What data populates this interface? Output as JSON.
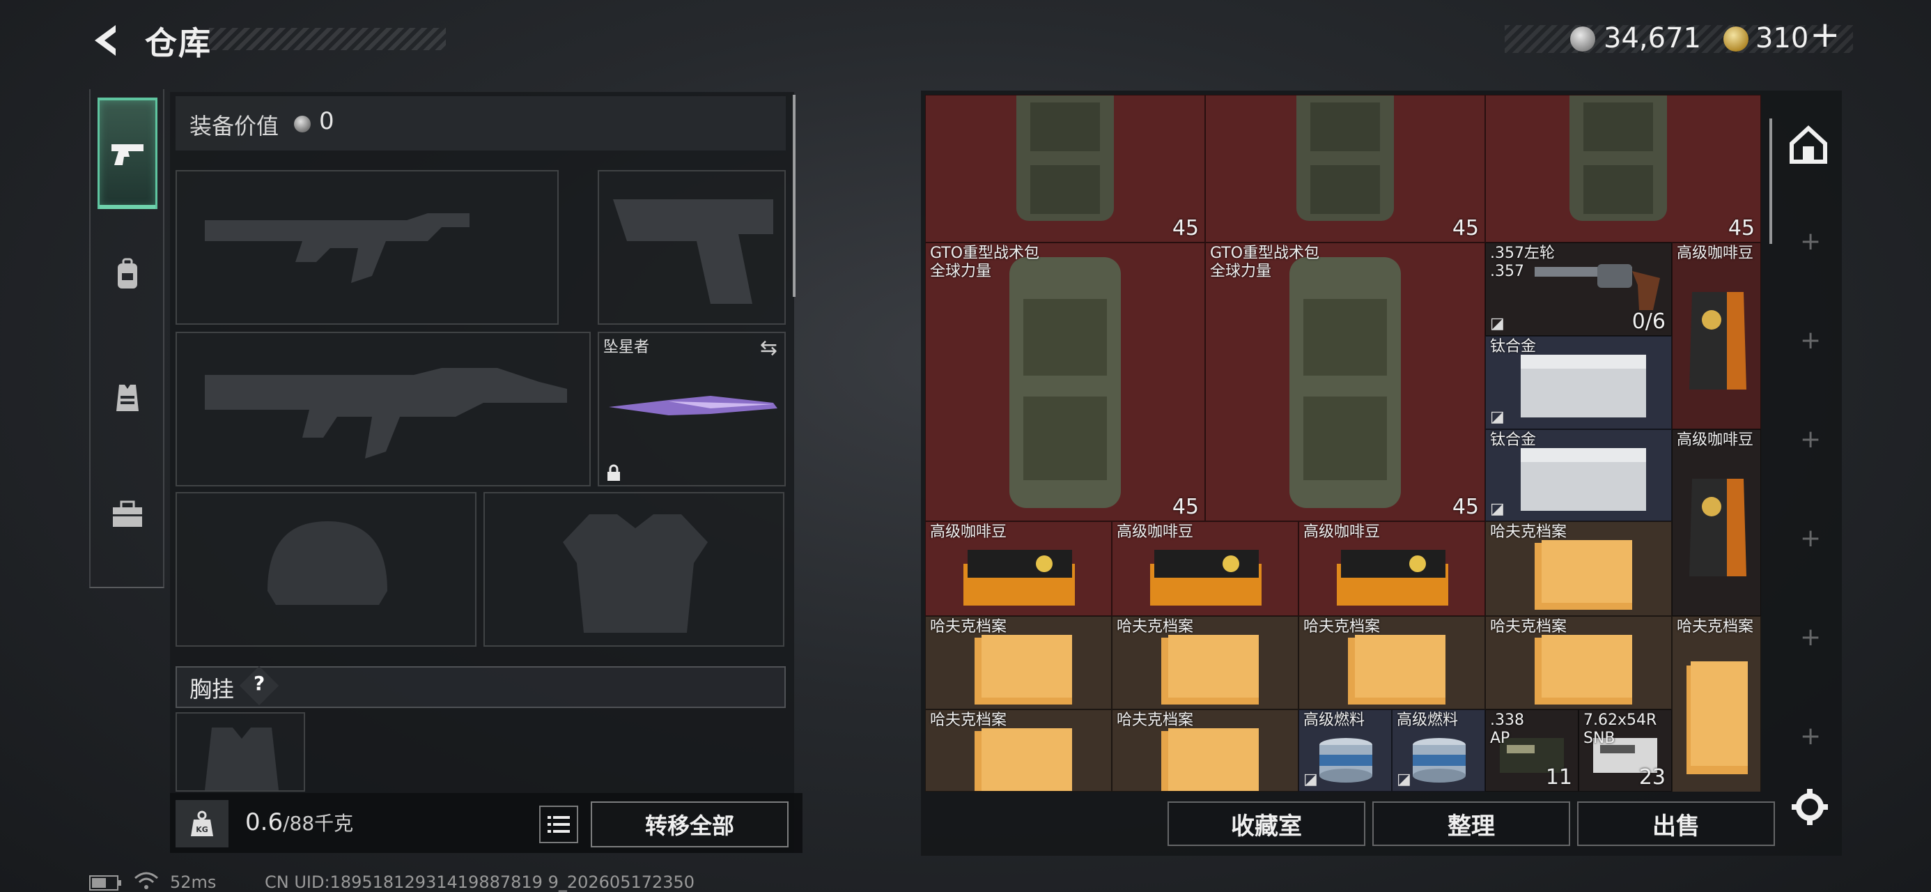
{
  "header": {
    "title": "仓库"
  },
  "currency": {
    "silver": "34,671",
    "gold": "310",
    "plus": "+"
  },
  "equipment": {
    "value_label": "装备价值",
    "value": "0",
    "melee_slot_label": "坠星者",
    "chest_rig_label": "胸挂",
    "chest_rig_help": "?"
  },
  "weight": {
    "current": "0.6",
    "max": "/88千克"
  },
  "buttons": {
    "transfer_all": "转移全部",
    "collection": "收藏室",
    "organize": "整理",
    "sell": "出售"
  },
  "grid_items": [
    {
      "id": "bp1",
      "name": "",
      "count": "45"
    },
    {
      "id": "bp2",
      "name": "",
      "count": "45"
    },
    {
      "id": "bp3",
      "name": "",
      "count": "45"
    },
    {
      "id": "bp4",
      "name": "GTO重型战术包\n全球力量",
      "count": "45"
    },
    {
      "id": "bp5",
      "name": "GTO重型战术包\n全球力量",
      "count": "45"
    },
    {
      "id": "rev",
      "name": ".357左轮\n.357",
      "count": "0/6"
    },
    {
      "id": "cb1",
      "name": "高级咖啡豆",
      "count": ""
    },
    {
      "id": "ti1",
      "name": "钛合金",
      "count": ""
    },
    {
      "id": "ti2",
      "name": "钛合金",
      "count": ""
    },
    {
      "id": "cb2",
      "name": "高级咖啡豆",
      "count": ""
    },
    {
      "id": "cb3",
      "name": "高级咖啡豆",
      "count": ""
    },
    {
      "id": "cb4",
      "name": "高级咖啡豆",
      "count": ""
    },
    {
      "id": "cb5",
      "name": "高级咖啡豆",
      "count": ""
    },
    {
      "id": "hf1",
      "name": "哈夫克档案",
      "count": ""
    },
    {
      "id": "hf2",
      "name": "哈夫克档案",
      "count": ""
    },
    {
      "id": "hf3",
      "name": "哈夫克档案",
      "count": ""
    },
    {
      "id": "hf4",
      "name": "哈夫克档案",
      "count": ""
    },
    {
      "id": "hf5",
      "name": "哈夫克档案",
      "count": ""
    },
    {
      "id": "hf6",
      "name": "哈夫克档案",
      "count": ""
    },
    {
      "id": "hf7",
      "name": "哈夫克档案",
      "count": ""
    },
    {
      "id": "hf8",
      "name": "哈夫克档案",
      "count": ""
    },
    {
      "id": "fu1",
      "name": "高级燃料",
      "count": ""
    },
    {
      "id": "fu2",
      "name": "高级燃料",
      "count": ""
    },
    {
      "id": "am1",
      "name": ".338\nAP",
      "count": "11"
    },
    {
      "id": "am2",
      "name": "7.62x54R\nSNB",
      "count": "23"
    }
  ],
  "status": {
    "ping": "52ms",
    "uid": "CN UID:18951812931419887819 9_202605172350"
  }
}
